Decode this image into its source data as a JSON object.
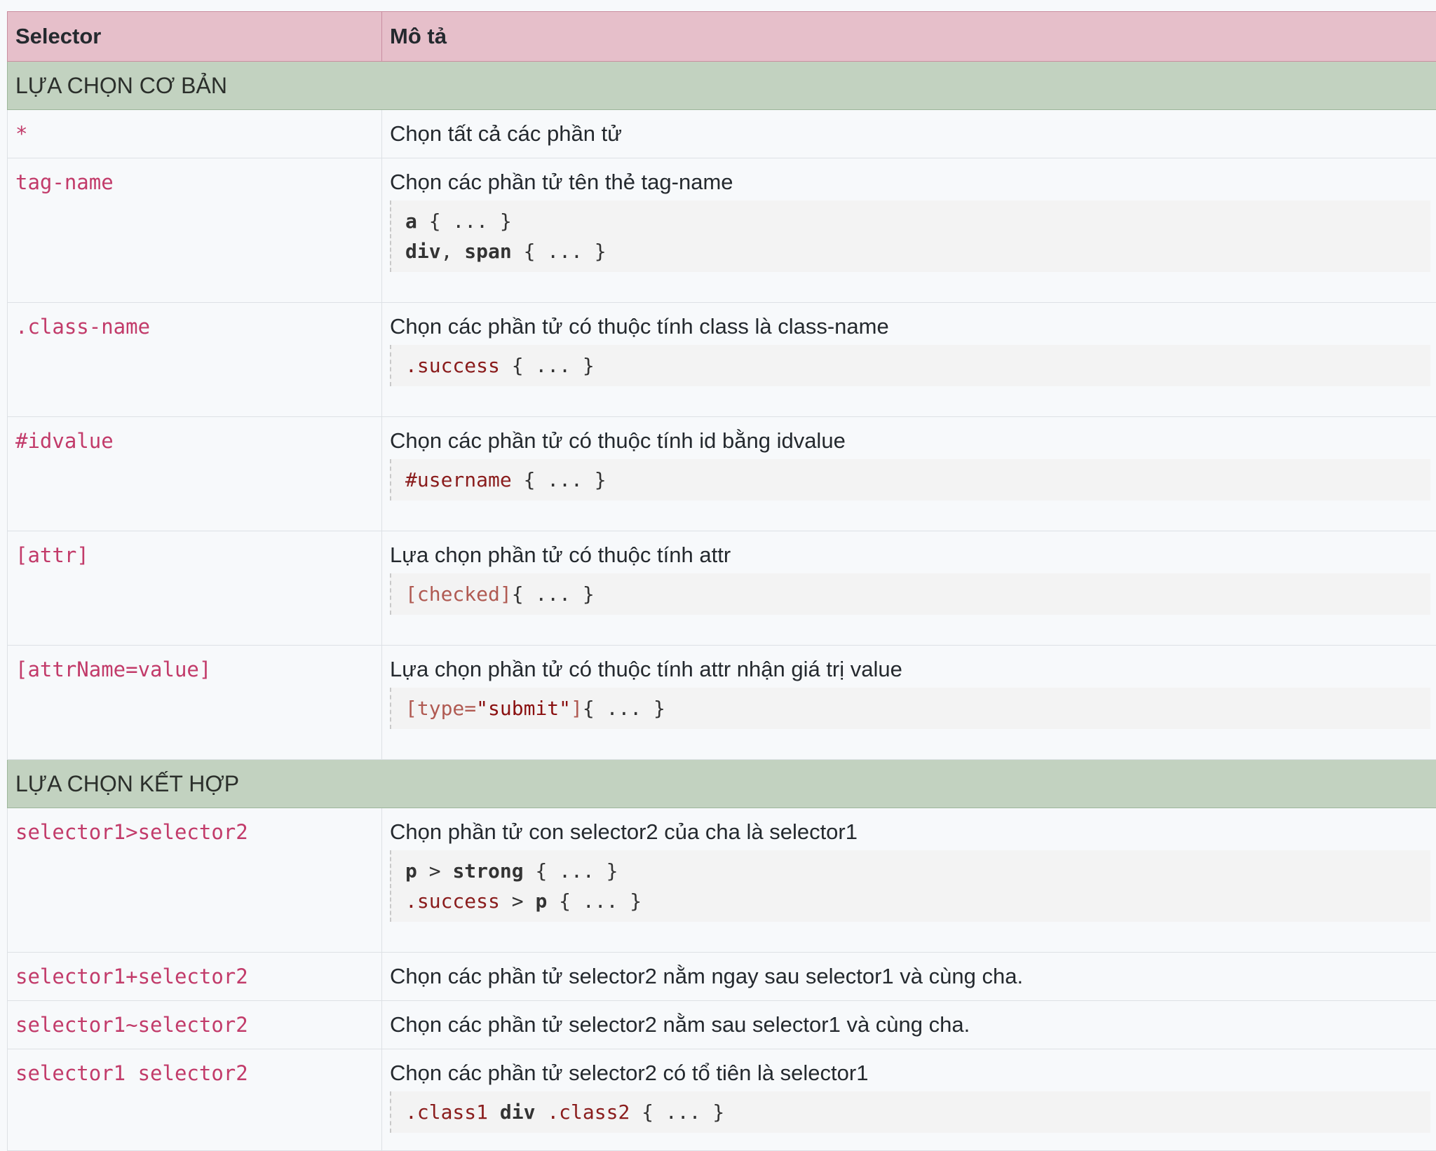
{
  "header": {
    "col_selector": "Selector",
    "col_desc": "Mô tả"
  },
  "sections": {
    "basic": "LỰA CHỌN CƠ BẢN",
    "combined": "LỰA CHỌN KẾT HỢP"
  },
  "rows": [
    {
      "selector": "*",
      "desc": "Chọn tất cả các phần tử"
    },
    {
      "selector": "tag-name",
      "desc": "Chọn các phần tử tên thẻ tag-name",
      "code": [
        [
          {
            "t": "a",
            "k": "kw"
          },
          {
            "t": " { ... }",
            "k": "pl"
          }
        ],
        [
          {
            "t": "div",
            "k": "kw"
          },
          {
            "t": ", ",
            "k": "pl"
          },
          {
            "t": "span",
            "k": "kw"
          },
          {
            "t": " { ... }",
            "k": "pl"
          }
        ]
      ]
    },
    {
      "selector": ".class-name",
      "desc": "Chọn các phần tử có thuộc tính class là class-name",
      "code": [
        [
          {
            "t": ".success",
            "k": "cls"
          },
          {
            "t": " { ... }",
            "k": "pl"
          }
        ]
      ]
    },
    {
      "selector": "#idvalue",
      "desc": "Chọn các phần tử có thuộc tính id bằng idvalue",
      "code": [
        [
          {
            "t": "#username",
            "k": "cls"
          },
          {
            "t": " { ... }",
            "k": "pl"
          }
        ]
      ]
    },
    {
      "selector": "[attr]",
      "desc": "Lựa chọn phần tử có thuộc tính attr",
      "code": [
        [
          {
            "t": "[checked]",
            "k": "attr"
          },
          {
            "t": "{ ... }",
            "k": "pl"
          }
        ]
      ]
    },
    {
      "selector": "[attrName=value]",
      "desc": "Lựa chọn phần tử có thuộc tính attr nhận giá trị value",
      "code": [
        [
          {
            "t": "[type=",
            "k": "attr"
          },
          {
            "t": "\"submit\"",
            "k": "str"
          },
          {
            "t": "]",
            "k": "attr"
          },
          {
            "t": "{ ... }",
            "k": "pl"
          }
        ]
      ]
    },
    {
      "selector": "selector1>selector2",
      "desc": "Chọn phần tử con selector2 của cha là selector1",
      "code": [
        [
          {
            "t": "p",
            "k": "kw"
          },
          {
            "t": " > ",
            "k": "pl"
          },
          {
            "t": "strong",
            "k": "kw"
          },
          {
            "t": " { ... }",
            "k": "pl"
          }
        ],
        [
          {
            "t": ".success",
            "k": "cls"
          },
          {
            "t": " > ",
            "k": "pl"
          },
          {
            "t": "p",
            "k": "kw"
          },
          {
            "t": " { ... }",
            "k": "pl"
          }
        ]
      ]
    },
    {
      "selector": "selector1+selector2",
      "desc": "Chọn các phần tử selector2 nằm ngay sau selector1 và cùng cha."
    },
    {
      "selector": "selector1~selector2",
      "desc": "Chọn các phần tử selector2 nằm sau selector1 và cùng cha."
    },
    {
      "selector": "selector1 selector2",
      "desc": "Chọn các phần tử selector2 có tổ tiên là selector1",
      "code": [
        [
          {
            "t": ".class1",
            "k": "cls"
          },
          {
            "t": " ",
            "k": "pl"
          },
          {
            "t": "div",
            "k": "kw"
          },
          {
            "t": " ",
            "k": "pl"
          },
          {
            "t": ".class2",
            "k": "cls"
          },
          {
            "t": " { ... }",
            "k": "pl"
          }
        ]
      ]
    }
  ]
}
